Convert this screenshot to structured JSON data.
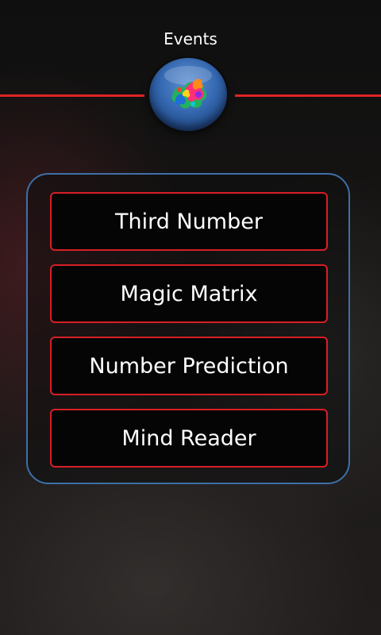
{
  "header": {
    "title": "Events",
    "logo_icon": "colorful-splash-orb-icon"
  },
  "menu": {
    "items": [
      {
        "label": "Third Number"
      },
      {
        "label": "Magic Matrix"
      },
      {
        "label": "Number Prediction"
      },
      {
        "label": "Mind Reader"
      }
    ]
  },
  "colors": {
    "accent_red": "#d61f26",
    "panel_border_blue": "#3e6fa8",
    "text": "#ffffff",
    "background": "#151515"
  }
}
